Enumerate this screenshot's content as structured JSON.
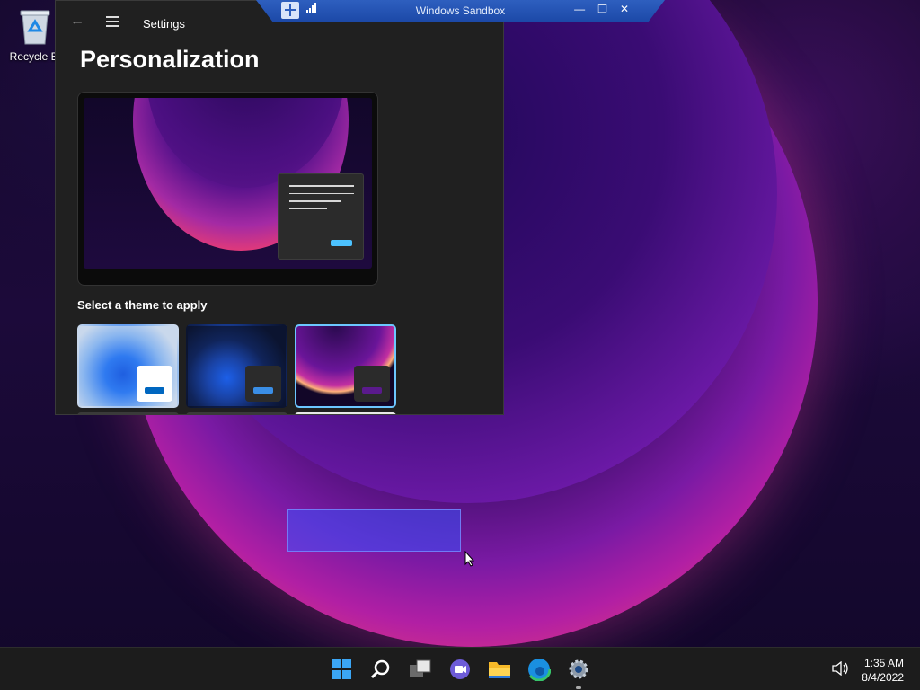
{
  "desktop": {
    "recycle_bin_label": "Recycle Bi"
  },
  "sandbox_bar": {
    "title": "Windows Sandbox"
  },
  "settings": {
    "app_title": "Settings",
    "page_title": "Personalization",
    "section_label": "Select a theme to apply",
    "themes": [
      {
        "style": "light",
        "selected": false
      },
      {
        "style": "dark",
        "selected": false
      },
      {
        "style": "glow",
        "selected": true
      }
    ]
  },
  "taskbar": {
    "icons": [
      "start-icon",
      "search-icon",
      "task-view-icon",
      "chat-icon",
      "file-explorer-icon",
      "edge-icon",
      "settings-icon"
    ],
    "time": "1:35 AM",
    "date": "8/4/2022"
  },
  "colors": {
    "accent": "#4cc2ff",
    "selected_border": "#6cc7ff",
    "taskbar_bg": "#1c1c1c",
    "settings_bg": "#202020"
  }
}
